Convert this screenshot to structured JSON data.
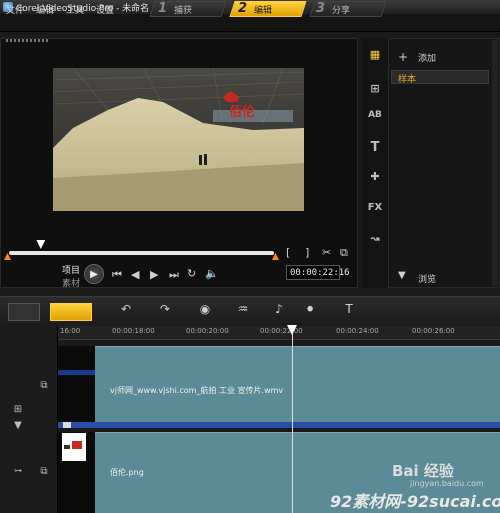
{
  "window": {
    "title": "Corel VideoStudio Pro - 未命名"
  },
  "menu": [
    "文件",
    "编辑",
    "工具",
    "设置"
  ],
  "steps": [
    {
      "num": "1",
      "label": "捕获"
    },
    {
      "num": "2",
      "label": "编辑"
    },
    {
      "num": "3",
      "label": "分享"
    }
  ],
  "active_step": 1,
  "player": {
    "mode_project": "项目",
    "mode_clip": "素材",
    "timecode": "00:00:22:16",
    "video_logo": "佰伦",
    "scrub_position_percent": 12
  },
  "library": {
    "add_label": "添加",
    "items": [
      "样本"
    ],
    "browse_label": "浏览",
    "side_icons": [
      "media-icon",
      "transition-icon",
      "title-icon",
      "text-icon",
      "graphics-icon",
      "filter-icon",
      "path-icon"
    ]
  },
  "timeline": {
    "ruler_ticks": [
      "16:00",
      "00:00:18:00",
      "00:00:20:00",
      "00:00:22:00",
      "00:00:24:00",
      "00:00:26:00"
    ],
    "video_clip_label": "vj师网_www.vjshi.com_航拍 工业 宣传片.wmv",
    "overlay_clip_label": "佰伦.png"
  },
  "watermarks": {
    "baidu": "Bai 经验",
    "baidu_url": "jingyan.baidu.com",
    "site": "92素材网-92sucai.com"
  },
  "colors": {
    "accent": "#f5b800",
    "clip": "#5c8a96",
    "video_bar": "#2a4ea8",
    "marker": "#ff8a00"
  }
}
